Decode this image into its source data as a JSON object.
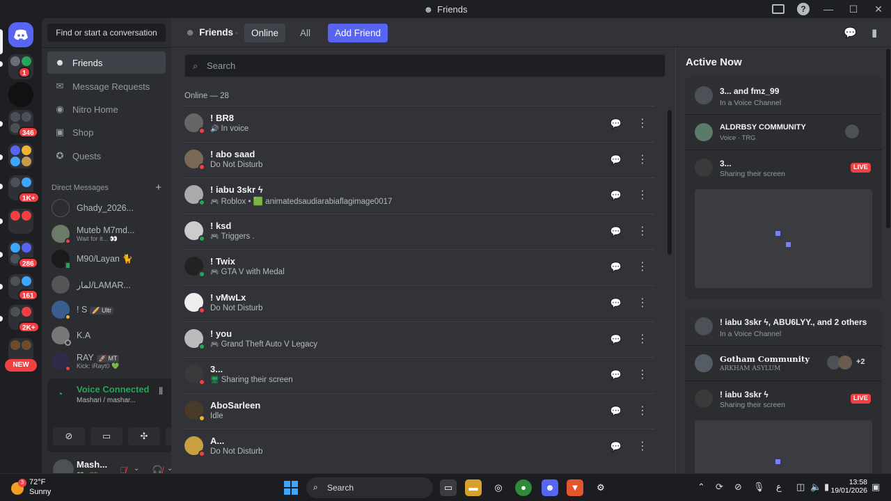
{
  "window": {
    "title": "Friends"
  },
  "servers": {
    "badges": [
      "1",
      "346",
      "1K+",
      "286",
      "161",
      "2K+"
    ],
    "new_label": "NEW"
  },
  "sidebar": {
    "search_label": "Find or start a conversation",
    "nav": [
      {
        "label": "Friends",
        "icon": "friends-icon"
      },
      {
        "label": "Message Requests",
        "icon": "envelope-icon"
      },
      {
        "label": "Nitro Home",
        "icon": "nitro-icon"
      },
      {
        "label": "Shop",
        "icon": "shop-icon"
      },
      {
        "label": "Quests",
        "icon": "quests-icon"
      }
    ],
    "dm_header": "Direct Messages",
    "dms": [
      {
        "name": "Ghady_2026...",
        "sub": ""
      },
      {
        "name": "Muteb M7md...",
        "sub": "Wait for it... 👀"
      },
      {
        "name": "M90/Layan 🐈",
        "sub": ""
      },
      {
        "name": "لمار/LAMAR...",
        "sub": ""
      },
      {
        "name": "! S",
        "tag": "🥖 Ultr",
        "sub": ""
      },
      {
        "name": "K.A",
        "sub": ""
      },
      {
        "name": "RAY",
        "tag": "🚀 MT",
        "sub": "Kick: iRayt0 💚"
      }
    ]
  },
  "voice": {
    "title": "Voice Connected",
    "channel": "Mashari / mashar..."
  },
  "user": {
    "name": "Mash...",
    "status": "💚 · 👑 ..."
  },
  "header": {
    "title": "Friends",
    "tabs": [
      "Online",
      "All"
    ],
    "add_friend": "Add Friend"
  },
  "friends": {
    "search_placeholder": "Search",
    "count_label": "Online — 28",
    "list": [
      {
        "name": "! BR8",
        "status": "In voice",
        "state": "dnd",
        "activity": "voice"
      },
      {
        "name": "! abo saad",
        "status": "Do Not Disturb",
        "state": "dnd",
        "activity": ""
      },
      {
        "name": "! iabu 3skr ϟ",
        "status": "Roblox • 🟩 animatedsaudiarabiaflagimage0017",
        "state": "online",
        "activity": "game"
      },
      {
        "name": "! ksd",
        "status": "Triggers .",
        "state": "online",
        "activity": "game"
      },
      {
        "name": "! Twix",
        "status": "GTA V with Medal",
        "state": "online",
        "activity": "game"
      },
      {
        "name": "! vMwLx",
        "status": "Do Not Disturb",
        "state": "dnd",
        "activity": ""
      },
      {
        "name": "! you",
        "status": "Grand Theft Auto V Legacy",
        "state": "online",
        "activity": "game"
      },
      {
        "name": "3...",
        "status": "Sharing their screen",
        "state": "dnd",
        "activity": "screen"
      },
      {
        "name": "AboSarleen",
        "status": "Idle",
        "state": "idle",
        "activity": ""
      },
      {
        "name": "A...",
        "status": "Do Not Disturb",
        "state": "dnd",
        "activity": ""
      }
    ]
  },
  "active_now": {
    "title": "Active Now",
    "cards": [
      {
        "title": "3... and fmz_99",
        "sub": "In a Voice Channel",
        "server": "ALDRBSY COMMUNITY",
        "server_sub": "Voice · TRG",
        "streamer": "3...",
        "streamer_sub": "Sharing their screen",
        "live": "LIVE"
      },
      {
        "title": "! iabu 3skr ϟ, ABU6LYY., and 2 others",
        "sub": "In a Voice Channel",
        "server": "Gotham Community",
        "server_sub": "ARKHAM ASYLUM",
        "extra": "+2",
        "streamer": "! iabu 3skr ϟ",
        "streamer_sub": "Sharing their screen",
        "live": "LIVE"
      }
    ]
  },
  "taskbar": {
    "weather_badge": "3",
    "temp": "72°F",
    "condition": "Sunny",
    "search": "Search",
    "time": "13:58",
    "date": "19/01/2026",
    "lang": "ع"
  },
  "colors": {
    "online": "#23a55a",
    "dnd": "#f23f43",
    "idle": "#f0b232",
    "accent": "#5865f2"
  }
}
